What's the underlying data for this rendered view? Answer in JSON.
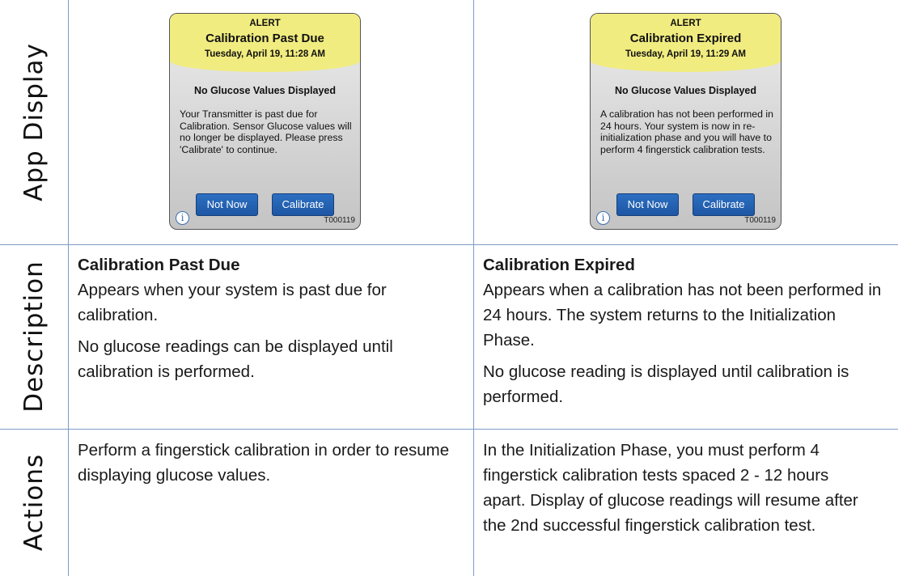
{
  "row_headers": {
    "app_display": "App Display",
    "description": "Description",
    "actions": "Actions"
  },
  "screens": [
    {
      "alert": "ALERT",
      "title": "Calibration Past Due",
      "date": "Tuesday, April 19, 11:28 AM",
      "subtitle": "No Glucose Values Displayed",
      "message": "Your Transmitter is past due for Calibration. Sensor Glucose values will no longer be displayed. Please press 'Calibrate' to continue.",
      "button_left": "Not Now",
      "button_right": "Calibrate",
      "info_icon": "i",
      "code": "T000119"
    },
    {
      "alert": "ALERT",
      "title": "Calibration Expired",
      "date": "Tuesday, April 19, 11:29 AM",
      "subtitle": "No Glucose Values Displayed",
      "message": "A calibration has not been performed in 24 hours. Your system is now in re-initialization phase and you will have to perform 4 fingerstick calibration tests.",
      "button_left": "Not Now",
      "button_right": "Calibrate",
      "info_icon": "i",
      "code": "T000119"
    }
  ],
  "descriptions": [
    {
      "title": "Calibration Past Due",
      "para1": "Appears when your system is past due for calibration.",
      "para2": "No glucose readings can be displayed until calibration is performed."
    },
    {
      "title": "Calibration Expired",
      "para1": "Appears when a calibration has not been performed in 24 hours. The system returns to the Initialization Phase.",
      "para2": "No glucose reading is displayed until calibration is performed."
    }
  ],
  "actions": [
    "Perform a fingerstick calibration in order to resume displaying glucose values.",
    "In the Initialization Phase, you must perform 4 fingerstick calibration tests spaced 2 - 12 hours apart. Display of glucose readings will resume after the 2nd successful fingerstick calibration test."
  ],
  "colors": {
    "grid_line": "#7d9cc5",
    "alert_header": "#f1ec7f",
    "button": "#1d56a3"
  }
}
